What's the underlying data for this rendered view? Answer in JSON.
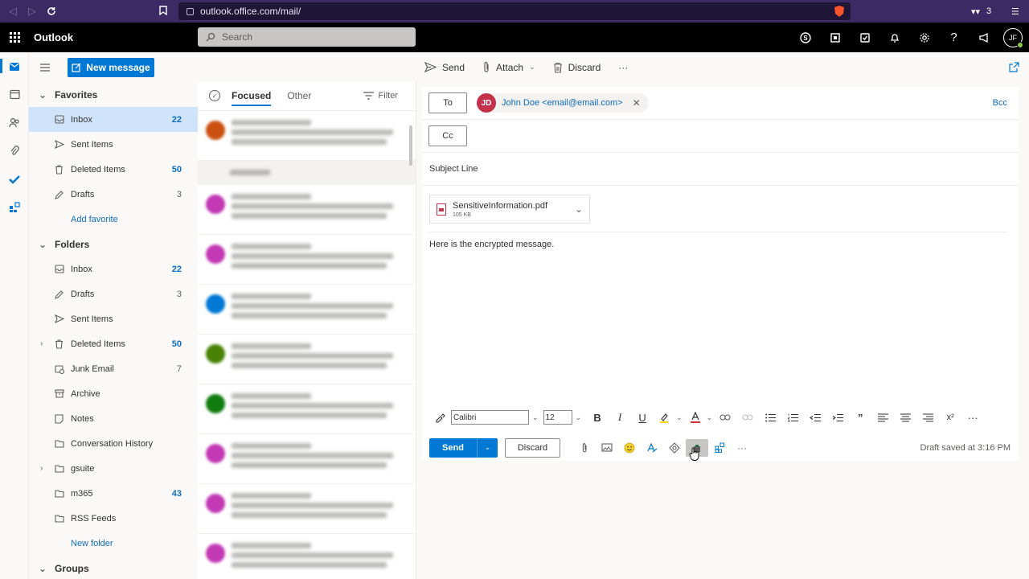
{
  "browser": {
    "url": "outlook.office.com/mail/",
    "ext_count": "3"
  },
  "header": {
    "app_name": "Outlook",
    "search_placeholder": "Search",
    "user_initials": "JF"
  },
  "folder_pane": {
    "new_message_label": "New message",
    "favorites_label": "Favorites",
    "favorites": [
      {
        "label": "Inbox",
        "count": "22"
      },
      {
        "label": "Sent Items",
        "count": ""
      },
      {
        "label": "Deleted Items",
        "count": "50"
      },
      {
        "label": "Drafts",
        "count": "3"
      }
    ],
    "add_favorite_label": "Add favorite",
    "folders_label": "Folders",
    "folders": [
      {
        "label": "Inbox",
        "count": "22"
      },
      {
        "label": "Drafts",
        "count": "3"
      },
      {
        "label": "Sent Items",
        "count": ""
      },
      {
        "label": "Deleted Items",
        "count": "50"
      },
      {
        "label": "Junk Email",
        "count": "7"
      },
      {
        "label": "Archive",
        "count": ""
      },
      {
        "label": "Notes",
        "count": ""
      },
      {
        "label": "Conversation History",
        "count": ""
      },
      {
        "label": "gsuite",
        "count": ""
      },
      {
        "label": "m365",
        "count": "43"
      },
      {
        "label": "RSS Feeds",
        "count": ""
      }
    ],
    "new_folder_label": "New folder",
    "groups_label": "Groups"
  },
  "message_list": {
    "tab_focused": "Focused",
    "tab_other": "Other",
    "filter_label": "Filter",
    "avatar_colors": [
      "#ca5010",
      "#c239b3",
      "#c239b3",
      "#0078d4",
      "#498205",
      "#107c10",
      "#c239b3",
      "#c239b3",
      "#c239b3"
    ]
  },
  "compose_toolbar": {
    "send_label": "Send",
    "attach_label": "Attach",
    "discard_label": "Discard",
    "more_label": "···"
  },
  "compose": {
    "to_label": "To",
    "recipient_initials": "JD",
    "recipient": "John Doe <email@email.com>",
    "bcc_label": "Bcc",
    "cc_label": "Cc",
    "subject": "Subject Line",
    "attachment_name": "SensitiveInformation.pdf",
    "attachment_size": "105 KB",
    "body": "Here is the encrypted message.",
    "font_name": "Calibri",
    "font_size": "12",
    "send_button": "Send",
    "discard_button": "Discard",
    "draft_status": "Draft saved at 3:16 PM"
  },
  "colors": {
    "accent": "#0078d4",
    "header_bg": "#000000",
    "browser_bg": "#3b2a63",
    "recipient_avatar": "#c4314b"
  }
}
